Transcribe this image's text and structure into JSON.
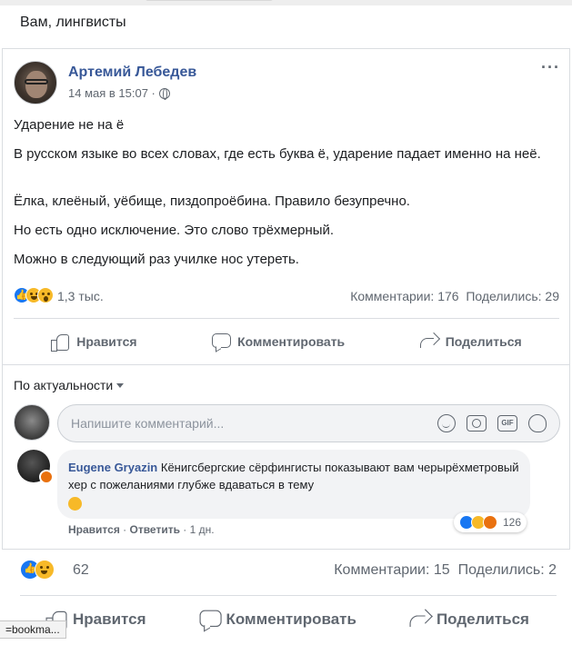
{
  "caption": "Вам, лингвисты",
  "post": {
    "author": "Артемий Лебедев",
    "timestamp": "14 мая в 15:07 ·",
    "more_icon": "more-dots-icon",
    "paragraphs": [
      "Ударение не на ё",
      "В русском языке во всех словах, где есть буква ё, ударение падает именно на неё.",
      "Ёлка, клеёный, уёбище, пиздопроёбина. Правило безупречно.",
      "Но есть одно исключение. Это слово трёхмерный.",
      "Можно в следующий раз училке нос утереть."
    ],
    "reactions_count": "1,3 тыс.",
    "comments_count": "Комментарии: 176",
    "shares_count": "Поделились: 29",
    "actions": {
      "like": "Нравится",
      "comment": "Комментировать",
      "share": "Поделиться"
    }
  },
  "comments": {
    "sort_label": "По актуальности",
    "input_placeholder": "Напишите комментарий...",
    "input_icons": [
      "emoji-icon",
      "camera-icon",
      "gif-icon",
      "sticker-icon"
    ],
    "gif_label": "GIF",
    "items": [
      {
        "author": "Eugene Gryazin",
        "text": "Кёнигсбергские сёрфингисты показывают вам черырёхметровый хер с пожеланиями глубже вдаваться в тему",
        "reaction_count": "126",
        "like_link": "Нравится",
        "reply_link": "Ответить",
        "age": "1 дн."
      }
    ]
  },
  "outer": {
    "reactions_count": "62",
    "comments_count": "Комментарии: 15",
    "shares_count": "Поделились: 2",
    "actions": {
      "like": "Нравится",
      "comment": "Комментировать",
      "share": "Поделиться"
    }
  },
  "statusbar_text": "=bookma...",
  "colors": {
    "link_blue": "#385898",
    "like_blue": "#1877f2",
    "haha_yellow": "#f7b928",
    "angry_orange": "#e9710f",
    "muted_text": "#606770",
    "border": "#dadde1"
  }
}
